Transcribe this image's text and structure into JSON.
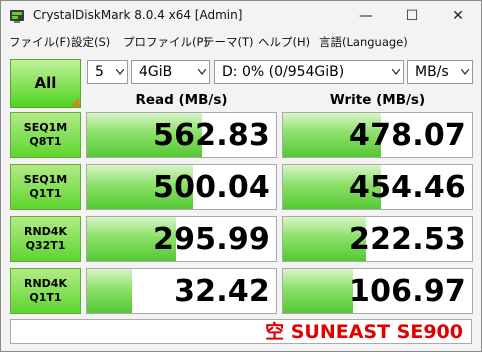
{
  "window": {
    "title": "CrystalDiskMark 8.0.4 x64 [Admin]",
    "minimize_glyph": "—",
    "maximize_glyph": "☐",
    "close_glyph": "✕"
  },
  "menu": [
    "ファイル(F)",
    "設定(S)",
    "プロファイル(P)",
    "テーマ(T)",
    "ヘルプ(H)",
    "言語(Language)"
  ],
  "controls": {
    "all_label": "All",
    "count": "5",
    "size": "4GiB",
    "drive": "D: 0% (0/954GiB)",
    "unit": "MB/s"
  },
  "headers": {
    "read": "Read (MB/s)",
    "write": "Write (MB/s)"
  },
  "rows": [
    {
      "label1": "SEQ1M",
      "label2": "Q8T1",
      "read": "562.83",
      "write": "478.07",
      "read_fill": 0.61,
      "write_fill": 0.52
    },
    {
      "label1": "SEQ1M",
      "label2": "Q1T1",
      "read": "500.04",
      "write": "454.46",
      "read_fill": 0.56,
      "write_fill": 0.52
    },
    {
      "label1": "RND4K",
      "label2": "Q32T1",
      "read": "295.99",
      "write": "222.53",
      "read_fill": 0.47,
      "write_fill": 0.44
    },
    {
      "label1": "RND4K",
      "label2": "Q1T1",
      "read": "32.42",
      "write": "106.97",
      "read_fill": 0.24,
      "write_fill": 0.37
    }
  ],
  "comment": "空 SUNEAST SE900",
  "colors": {
    "accent_green": "#54c832",
    "comment_red": "#e00000",
    "all_corner_orange": "#e8781c"
  }
}
